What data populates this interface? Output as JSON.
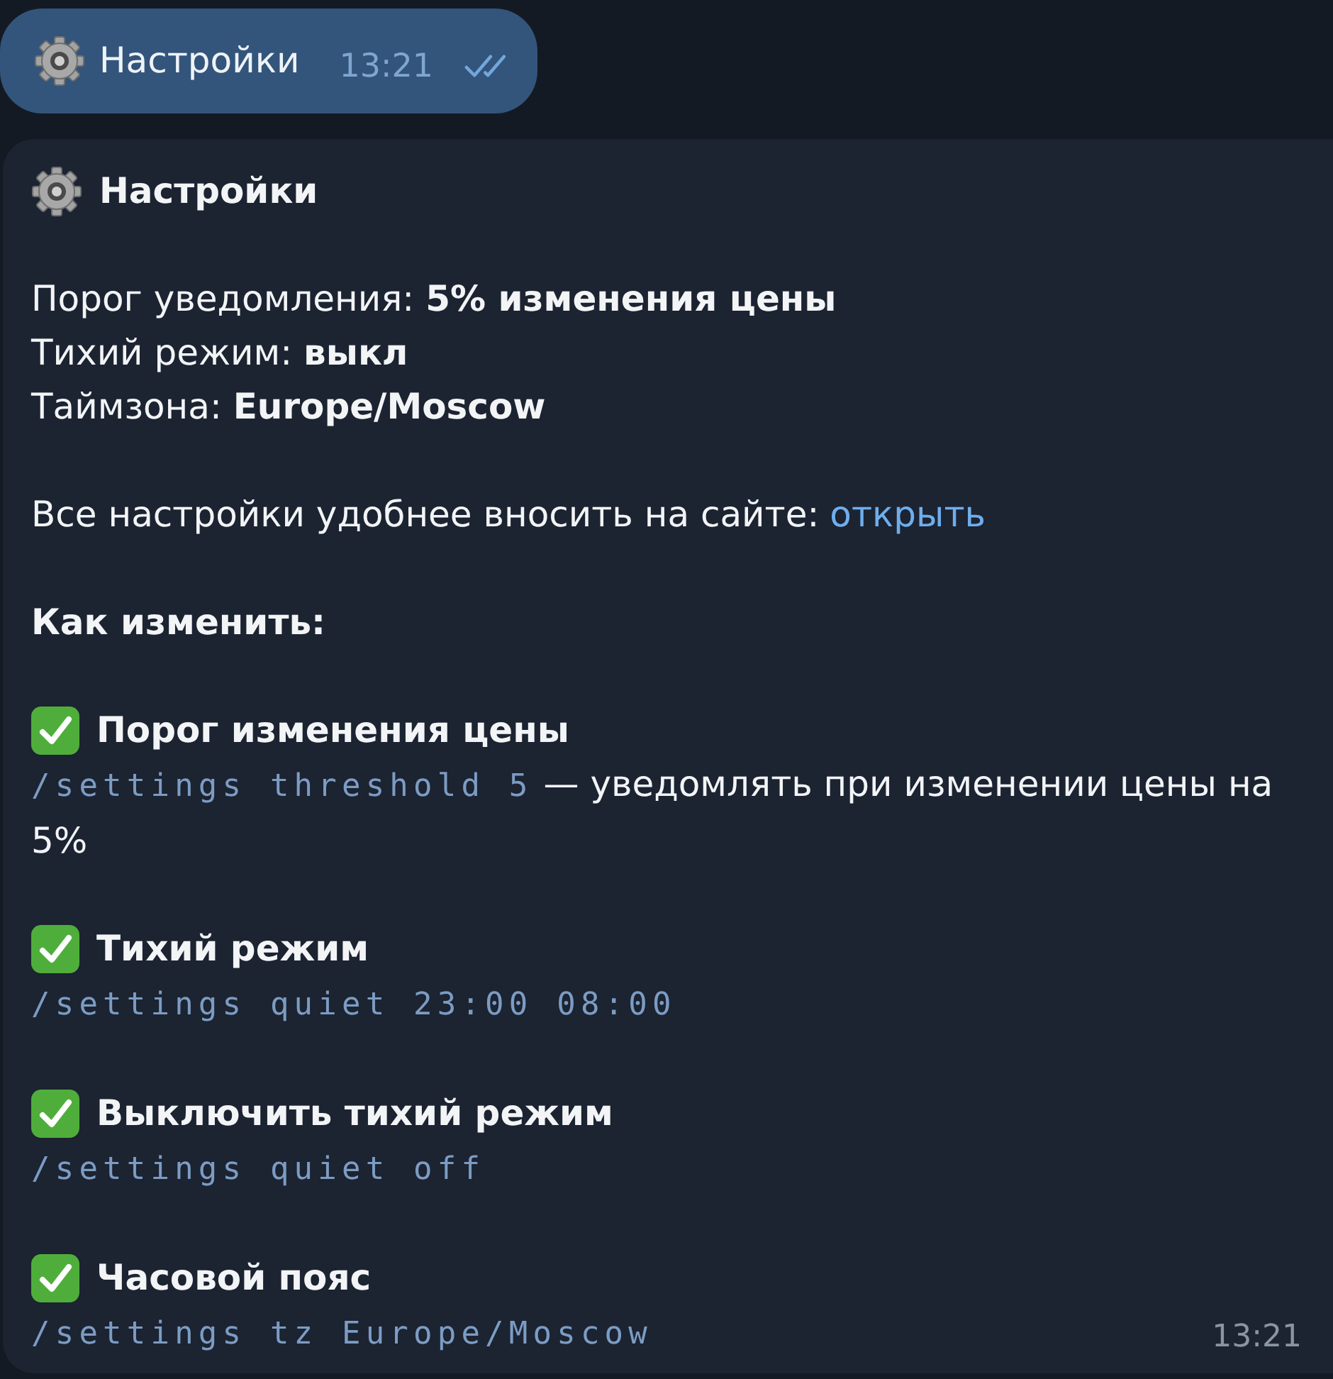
{
  "outgoing_message": {
    "text": "Настройки",
    "time": "13:21",
    "read": true
  },
  "incoming_message": {
    "title": "Настройки",
    "status_lines": [
      "Порог уведомления: **5% изменения цены**",
      "Тихий режим: **выкл**",
      "Таймзона: **Europe/Moscow**"
    ],
    "site_note": {
      "text": "Все настройки удобнее вносить на сайте:",
      "link": "открыть"
    },
    "heading": "Как изменить:",
    "commands": [
      {
        "title": "Порог изменения цены",
        "command": "/settings threshold 5",
        "description": "— уведомлять при изменении цены на 5%"
      },
      {
        "title": "Тихий режим",
        "command": "/settings quiet 23:00 08:00"
      },
      {
        "title": "Выключить тихий режим",
        "command": "/settings quiet off"
      },
      {
        "title": "Часовой пояс",
        "command": "/settings tz Europe/Moscow"
      }
    ],
    "time": "13:21"
  }
}
